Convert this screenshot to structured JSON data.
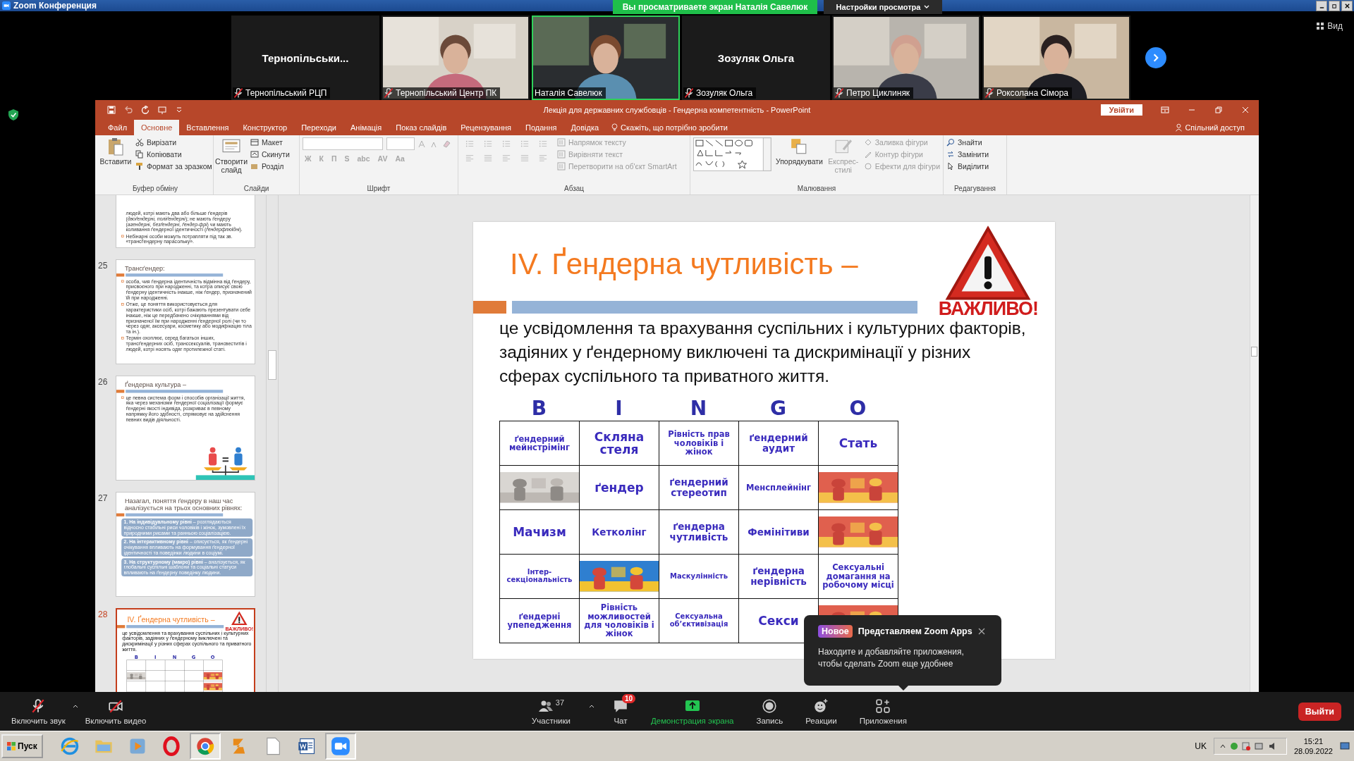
{
  "zoom_window": {
    "title": "Zoom Конференция",
    "share_banner": "Вы просматриваете экран Наталія Савелюк",
    "view_settings": "Настройки просмотра",
    "view_button": "Вид"
  },
  "participants": [
    {
      "kind": "name",
      "caption": "Тернопільськи...",
      "name": "Тернопільський РЦП",
      "muted": true,
      "speaking": false
    },
    {
      "kind": "video",
      "name": "Тернопільський Центр ПК",
      "muted": true,
      "speaking": false
    },
    {
      "kind": "video",
      "name": "Наталія Савелюк",
      "muted": false,
      "speaking": true
    },
    {
      "kind": "name",
      "caption": "Зозуляк Ольга",
      "name": "Зозуляк Ольга",
      "muted": true,
      "speaking": false
    },
    {
      "kind": "video",
      "name": "Петро Циклиняк",
      "muted": true,
      "speaking": false
    },
    {
      "kind": "video",
      "name": "Роксолана Сімора",
      "muted": true,
      "speaking": false
    }
  ],
  "powerpoint": {
    "title": "Лекція для державних службовців - Гендерна компетентність - PowerPoint",
    "sign_in": "Увійти",
    "tabs": [
      {
        "label": "Файл",
        "selected": false
      },
      {
        "label": "Основне",
        "selected": true
      },
      {
        "label": "Вставлення",
        "selected": false
      },
      {
        "label": "Конструктор",
        "selected": false
      },
      {
        "label": "Переходи",
        "selected": false
      },
      {
        "label": "Анімація",
        "selected": false
      },
      {
        "label": "Показ слайдів",
        "selected": false
      },
      {
        "label": "Рецензування",
        "selected": false
      },
      {
        "label": "Подання",
        "selected": false
      },
      {
        "label": "Довідка",
        "selected": false
      }
    ],
    "tell_me": "Скажіть, що потрібно зробити",
    "share": "Спільний доступ",
    "ribbon": {
      "clipboard": {
        "label": "Буфер обміну",
        "paste": "Вставити",
        "items": [
          "Вирізати",
          "Копіювати",
          "Формат за зразком"
        ]
      },
      "slides": {
        "label": "Слайди",
        "new_slide": "Створити слайд",
        "items": [
          "Макет",
          "Скинути",
          "Розділ"
        ]
      },
      "font": {
        "label": "Шрифт",
        "format_buttons": [
          {
            "label": "Ж",
            "disabled": true
          },
          {
            "label": "К",
            "disabled": true
          },
          {
            "label": "П",
            "disabled": true
          },
          {
            "label": "S",
            "disabled": true
          },
          {
            "label": "abc",
            "disabled": true
          },
          {
            "label": "AV",
            "disabled": true
          },
          {
            "label": "Aa",
            "disabled": true
          }
        ]
      },
      "paragraph": {
        "label": "Абзац",
        "items": [
          {
            "label": "Напрямок тексту",
            "disabled": true
          },
          {
            "label": "Вирівняти текст",
            "disabled": true
          },
          {
            "label": "Перетворити на об'єкт SmartArt",
            "disabled": true
          }
        ]
      },
      "drawing": {
        "label": "Малювання",
        "arrange": "Упорядкувати",
        "quick_styles": {
          "label": "Експрес-стилі",
          "disabled": true
        },
        "items": [
          {
            "label": "Заливка фігури",
            "disabled": true
          },
          {
            "label": "Контур фігури",
            "disabled": true
          },
          {
            "label": "Ефекти для фігури",
            "disabled": true
          }
        ]
      },
      "editing": {
        "label": "Редагування",
        "items": [
          "Знайти",
          "Замінити",
          "Виділити"
        ]
      }
    },
    "thumbnails": [
      {
        "kind": "bullets",
        "selected": false,
        "continuation": "людей, котрі мають два або більше ґендерів (*двоґендерні, поліґендерні*); не мають ґендеру (*агендерні, безґендерні, ґендер-фрі*) чи мають коливання ґендерної ідентичності (*ґендерфлюїдні*).",
        "bullets": [
          "Небінарні особи можуть потрапляти під так зв. «трансґендерну парасольку»."
        ]
      },
      {
        "kind": "bullets",
        "number": "25",
        "selected": false,
        "title": "Трансґендер:",
        "bullets": [
          "особа, чия ґендерна ідентичність відмінна від ґендеру, присвоєного при народженні, та котра описує свою ґендерну ідентичність інакше, ніж ґендер, призначений їй при народженні.",
          "Отже, це поняття використовується для характеристики осіб, котрі бажають презентувати себе інакше, ніж це передбачено очікуваннями від призначеної їм при народженні ґендерної ролі (чи то через одяг, аксесуари, косметику або модифікацію тіла та ін.).",
          "Термін охоплює, серед багатьох інших, трансґендерних осіб, транссексуалів, трансвеститів і людей, котрі носять одяг протилежної статі."
        ]
      },
      {
        "kind": "illustrated",
        "number": "26",
        "selected": false,
        "title": "Ґендерна культура –",
        "bullets": [
          "це певна система форм і способів організації життя, яка через механізми ґендерної соціалізації формує ґендерні якості індивіда, розкриває в певному напрямку його здібності, спрямовує на здійснення певних видів діяльності."
        ]
      },
      {
        "kind": "boxes",
        "number": "27",
        "selected": false,
        "title": "Назагал, поняття ґендеру в наш час аналізується на трьох основних рівнях:",
        "boxes": [
          "**1. На індивідуальному рівні** – розглядаються відносно стабільні риси чоловіків і жінок, зумовлені їх природними рисами та ранньою соціалізацією.",
          "**2. На інтерактивному рівні** – описується, як ґендерні очікування впливають на формування ґендерної ідентичності та поведінки людини в соціумі.",
          "**3. На структурному (макро) рівні** – аналізується, як глобальні суспільні шаблони та соціальні статуси впливають на ґендерну поведінку людини."
        ]
      },
      {
        "kind": "slide",
        "number": "28",
        "selected": true,
        "slide": {
          "title": "IV. Ґендерна чутливість –",
          "badge": "ВАЖЛИВО!",
          "body": "це усвідомлення та врахування суспільних і культурних факторів, задіяних у ґендерному виключені та дискримінації у різних сферах суспільного та приватного життя.",
          "letters": [
            "B",
            "I",
            "N",
            "G",
            "O"
          ],
          "cells": [
            [
              {
                "kind": "text"
              },
              {
                "kind": "text"
              },
              {
                "kind": "text"
              },
              {
                "kind": "text"
              },
              {
                "kind": "text"
              }
            ],
            [
              {
                "kind": "picture"
              },
              {
                "kind": "text"
              },
              {
                "kind": "text"
              },
              {
                "kind": "text"
              },
              {
                "kind": "picture"
              }
            ],
            [
              {
                "kind": "text"
              },
              {
                "kind": "text"
              },
              {
                "kind": "text"
              },
              {
                "kind": "text"
              },
              {
                "kind": "picture"
              }
            ]
          ]
        }
      }
    ],
    "slide": {
      "title": "IV. Ґендерна чутливість –",
      "badge": "ВАЖЛИВО!",
      "body": "це усвідомлення та врахування суспільних і культурних факторів, задіяних у ґендерному виключені та дискримінації у різних сферах суспільного та приватного життя.",
      "letters": [
        "B",
        "I",
        "N",
        "G",
        "O"
      ],
      "cells": [
        [
          {
            "kind": "text",
            "text": "ґендерний мейнстрімінг"
          },
          {
            "kind": "text",
            "text": "Скляна стеля"
          },
          {
            "kind": "text",
            "text": "Рівність прав чоловіків і жінок"
          },
          {
            "kind": "text",
            "text": "ґендерний аудит"
          },
          {
            "kind": "text",
            "text": "Стать"
          }
        ],
        [
          {
            "kind": "picture"
          },
          {
            "kind": "text",
            "text": "ґендер"
          },
          {
            "kind": "text",
            "text": "ґендерний стереотип"
          },
          {
            "kind": "text",
            "text": "Менсплейнінг"
          },
          {
            "kind": "picture"
          }
        ],
        [
          {
            "kind": "text",
            "text": "Мачизм"
          },
          {
            "kind": "text",
            "text": "Кетколінг"
          },
          {
            "kind": "text",
            "text": "ґендерна чутливість"
          },
          {
            "kind": "text",
            "text": "Фемінітиви"
          },
          {
            "kind": "picture"
          }
        ],
        [
          {
            "kind": "text",
            "text": "Інтер-секціональність"
          },
          {
            "kind": "picture"
          },
          {
            "kind": "text",
            "text": "Маскулінність"
          },
          {
            "kind": "text",
            "text": "ґендерна нерівність"
          },
          {
            "kind": "text",
            "text": "Сексуальні домагання на робочому місці"
          }
        ],
        [
          {
            "kind": "text",
            "text": "ґендерні упепедження"
          },
          {
            "kind": "text",
            "text": "Рівність можливостей для чоловіків і жінок"
          },
          {
            "kind": "text",
            "text": "Сексуальна об’єктивізація"
          },
          {
            "kind": "text",
            "text": "Секси"
          },
          {
            "kind": "picture"
          }
        ]
      ]
    }
  },
  "popup": {
    "badge": "Новое",
    "title": "Представляем Zoom Apps",
    "text": "Находите и добавляйте приложения, чтобы сделать Zoom еще удобнее"
  },
  "toolbar": {
    "unmute": "Включить звук",
    "start_video": "Включить видео",
    "participants": "Участники",
    "participant_count": "37",
    "chat": "Чат",
    "chat_badge": "10",
    "share": "Демонстрация экрана",
    "record": "Запись",
    "reactions": "Реакции",
    "apps": "Приложения",
    "leave": "Выйти"
  },
  "taskbar": {
    "start": "Пуск",
    "apps": [
      {
        "kind": "browser",
        "selected": false
      },
      {
        "kind": "folder",
        "selected": false
      },
      {
        "kind": "media",
        "selected": false
      },
      {
        "kind": "opera",
        "selected": false
      },
      {
        "kind": "chrome",
        "selected": true
      },
      {
        "kind": "archive",
        "selected": false
      },
      {
        "kind": "file",
        "selected": false
      },
      {
        "kind": "word",
        "selected": false
      },
      {
        "kind": "camera",
        "selected": true
      }
    ],
    "language": "UK",
    "time": "15:21",
    "date": "28.09.2022"
  }
}
